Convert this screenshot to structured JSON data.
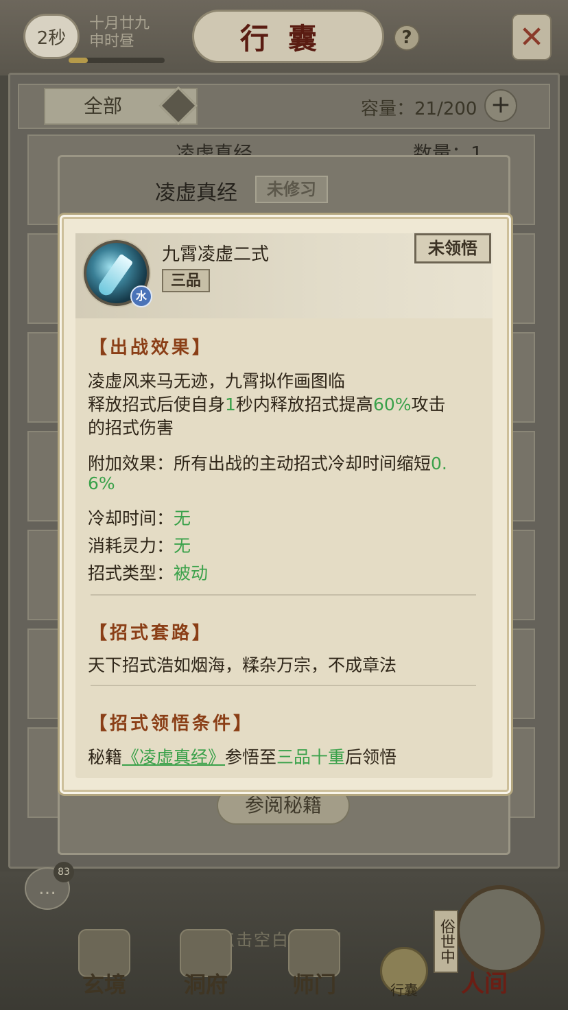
{
  "header": {
    "timer": "2秒",
    "date_line1": "十月廿九",
    "date_line2": "申时昼",
    "title": "行囊",
    "help_icon": "question-mark-icon",
    "close_icon": "close-x-icon"
  },
  "filter": {
    "selected": "全部",
    "capacity_label": "容量：21/200"
  },
  "background_list": {
    "item_name": "凌虚真经",
    "count_label": "数量：1"
  },
  "background_detail": {
    "title": "凌虚真经",
    "status": "未修习",
    "read_button": "参阅秘籍"
  },
  "popup": {
    "skill_name": "九霄凌虚二式",
    "grade": "三品",
    "element": "水",
    "state": "未领悟",
    "battle_title": "【出战效果】",
    "battle_line1": "凌虚风来马无迹，九霄拟作画图临",
    "battle_line2_a": "释放招式后使自身",
    "battle_line2_b": "1",
    "battle_line2_c": "秒内释放招式提高",
    "battle_line2_d": "60%",
    "battle_line2_e": "攻击",
    "battle_line3": "的招式伤害",
    "extra_a": "附加效果：所有出战的主动招式冷却时间缩短",
    "extra_b": "0.",
    "extra_c": "6%",
    "cooldown_label": "冷却时间：",
    "cooldown_value": "无",
    "cost_label": "消耗灵力：",
    "cost_value": "无",
    "type_label": "招式类型：",
    "type_value": "被动",
    "combo_title": "【招式套路】",
    "combo_text": "天下招式浩如烟海，糅杂万宗，不成章法",
    "cond_title": "【招式领悟条件】",
    "cond_a": "秘籍",
    "cond_book": "《凌虚真经》",
    "cond_b": "参悟至",
    "cond_level": "三品十重",
    "cond_c": "后领悟"
  },
  "bottom": {
    "chat_badge": "83",
    "return_hint": "点击空白处返回",
    "nav": [
      "玄境",
      "洞府",
      "师门"
    ],
    "bag_quick": "行囊",
    "world_tag": "俗世中",
    "world_label": "人间"
  },
  "colors": {
    "highlight_green": "#3aa14a",
    "section_title": "#8a3e16",
    "title_red": "#5a1c12"
  }
}
